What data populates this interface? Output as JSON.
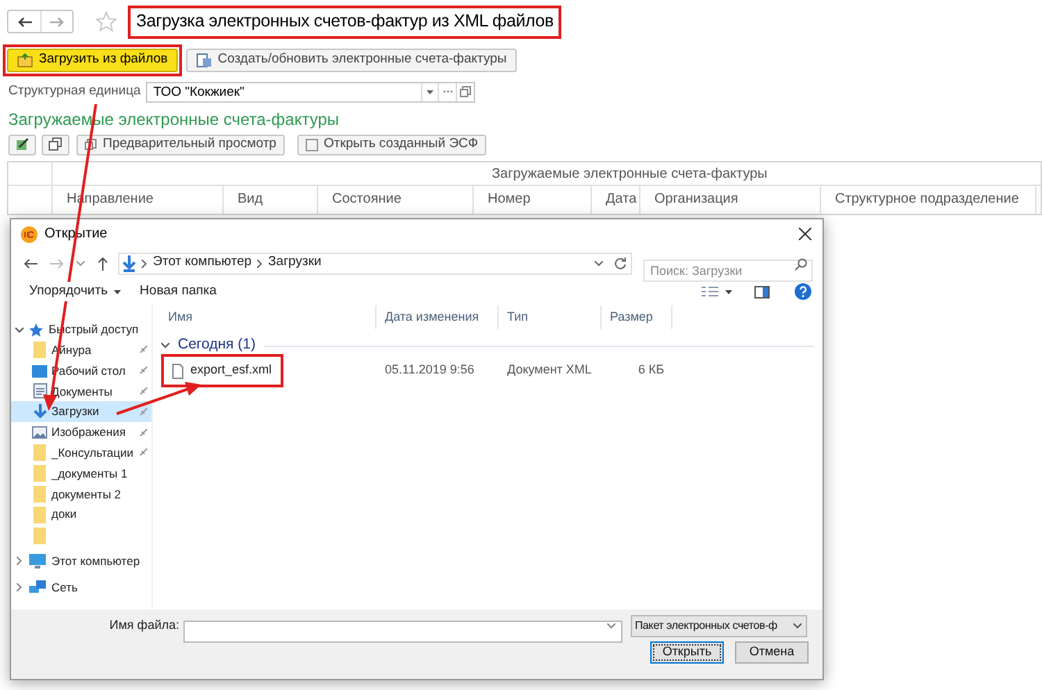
{
  "form": {
    "title": "Загрузка электронных счетов-фактур из XML файлов",
    "title_highlighted": true,
    "commands": [
      {
        "label": "Загрузить из файлов",
        "kind": "primary",
        "highlighted": true
      },
      {
        "label": "Создать/обновить электронные счета-фактуры",
        "kind": "normal",
        "highlighted": false
      }
    ],
    "unit": {
      "label": "Структурная единица",
      "value": "ТОО \"Кокжиек\""
    },
    "section_title": "Загружаемые электронные счета-фактуры",
    "table_toolbar": [
      "Предварительный просмотр",
      "Открыть созданный ЭСФ"
    ],
    "table": {
      "group_header": "Загружаемые электронные счета-фактуры",
      "columns": [
        "Направление",
        "Вид",
        "Состояние",
        "Номер",
        "Дата",
        "Организация",
        "Структурное подразделение"
      ]
    }
  },
  "dialog": {
    "title": "Открытие",
    "path": [
      "Этот компьютер",
      "Загрузки"
    ],
    "search_placeholder": "Поиск: Загрузки",
    "toolbar": [
      "Упорядочить",
      "Новая папка"
    ],
    "nav": [
      {
        "label": "Быстрый доступ",
        "kind": "star",
        "expanded": true,
        "children": [
          {
            "label": "Айнура",
            "kind": "folder",
            "pinned": true,
            "selected": false
          },
          {
            "label": "Рабочий стол",
            "kind": "desktop",
            "pinned": true,
            "selected": false
          },
          {
            "label": "Документы",
            "kind": "docs",
            "pinned": true,
            "selected": false
          },
          {
            "label": "Загрузки",
            "kind": "download",
            "pinned": true,
            "selected": true
          },
          {
            "label": "Изображения",
            "kind": "images",
            "pinned": true,
            "selected": false
          },
          {
            "label": "_Консультации",
            "kind": "folder",
            "pinned": true,
            "selected": false
          },
          {
            "label": "_документы 1",
            "kind": "folder",
            "pinned": false,
            "selected": false
          },
          {
            "label": "документы 2",
            "kind": "folder",
            "pinned": false,
            "selected": false
          },
          {
            "label": "доки",
            "kind": "folder",
            "pinned": false,
            "selected": false
          },
          {
            "kind": "folder",
            "pinned": false,
            "selected": false
          }
        ]
      },
      {
        "label": "Этот компьютер",
        "kind": "computer",
        "expanded": false
      },
      {
        "label": "Сеть",
        "kind": "network",
        "expanded": false
      }
    ],
    "columns": [
      "Имя",
      "Дата изменения",
      "Тип",
      "Размер"
    ],
    "group": {
      "label": "Сегодня (1)",
      "expanded": true
    },
    "files": [
      {
        "name": "export_esf.xml",
        "modified": "05.11.2019 9:56",
        "type": "Документ XML",
        "size": "6 КБ",
        "highlighted": true
      }
    ],
    "filename_label": "Имя файла:",
    "filetype": "Пакет электронных счетов-ф",
    "buttons": [
      {
        "label": "Открыть",
        "focused": true
      },
      {
        "label": "Отмена",
        "focused": false
      }
    ]
  }
}
